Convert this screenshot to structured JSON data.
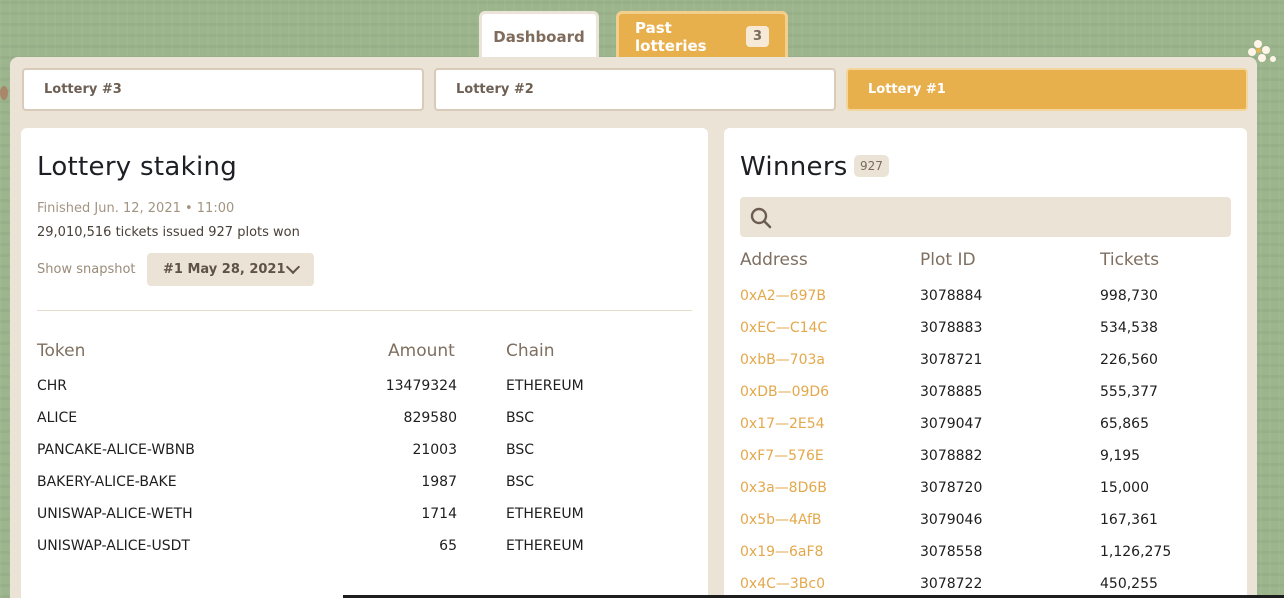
{
  "top_tabs": [
    {
      "label": "Dashboard"
    },
    {
      "label": "Past lotteries",
      "count": "3"
    }
  ],
  "lottery_tabs": [
    {
      "label": "Lottery #3"
    },
    {
      "label": "Lottery #2"
    },
    {
      "label": "Lottery #1",
      "active": true
    }
  ],
  "staking": {
    "title": "Lottery staking",
    "finished": "Finished Jun. 12, 2021 • 11:00",
    "summary": "29,010,516 tickets issued 927 plots won",
    "snapshot_label": "Show snapshot",
    "snapshot_value": "#1 May 28, 2021",
    "headers": {
      "token": "Token",
      "amount": "Amount",
      "chain": "Chain"
    },
    "rows": [
      {
        "token": "CHR",
        "amount": "13479324",
        "chain": "ETHEREUM"
      },
      {
        "token": "ALICE",
        "amount": "829580",
        "chain": "BSC"
      },
      {
        "token": "PANCAKE-ALICE-WBNB",
        "amount": "21003",
        "chain": "BSC"
      },
      {
        "token": "BAKERY-ALICE-BAKE",
        "amount": "1987",
        "chain": "BSC"
      },
      {
        "token": "UNISWAP-ALICE-WETH",
        "amount": "1714",
        "chain": "ETHEREUM"
      },
      {
        "token": "UNISWAP-ALICE-USDT",
        "amount": "65",
        "chain": "ETHEREUM"
      }
    ]
  },
  "winners": {
    "title": "Winners",
    "count": "927",
    "search_placeholder": "",
    "headers": {
      "address": "Address",
      "plot": "Plot ID",
      "tickets": "Tickets"
    },
    "rows": [
      {
        "address": "0xA2—697B",
        "plot": "3078884",
        "tickets": "998,730"
      },
      {
        "address": "0xEC—C14C",
        "plot": "3078883",
        "tickets": "534,538"
      },
      {
        "address": "0xbB—703a",
        "plot": "3078721",
        "tickets": "226,560"
      },
      {
        "address": "0xDB—09D6",
        "plot": "3078885",
        "tickets": "555,377"
      },
      {
        "address": "0x17—2E54",
        "plot": "3079047",
        "tickets": "65,865"
      },
      {
        "address": "0xF7—576E",
        "plot": "3078882",
        "tickets": "9,195"
      },
      {
        "address": "0x3a—8D6B",
        "plot": "3078720",
        "tickets": "15,000"
      },
      {
        "address": "0x5b—4AfB",
        "plot": "3079046",
        "tickets": "167,361"
      },
      {
        "address": "0x19—6aF8",
        "plot": "3078558",
        "tickets": "1,126,275"
      },
      {
        "address": "0x4C—3Bc0",
        "plot": "3078722",
        "tickets": "450,255"
      }
    ]
  },
  "colors": {
    "accent": "#e8af4d",
    "background": "#9cb58c",
    "frame": "#ece3d7"
  }
}
